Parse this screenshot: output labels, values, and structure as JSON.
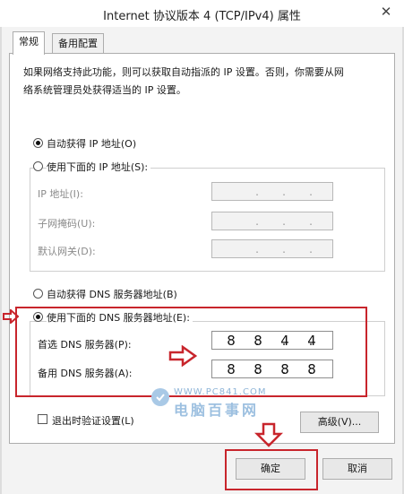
{
  "window": {
    "title": "Internet 协议版本 4 (TCP/IPv4) 属性"
  },
  "tabs": [
    {
      "label": "常规",
      "active": true
    },
    {
      "label": "备用配置",
      "active": false
    }
  ],
  "description": [
    "如果网络支持此功能，则可以获取自动指派的 IP 设置。否则，你需要从网",
    "络系统管理员处获得适当的 IP 设置。"
  ],
  "ip": {
    "auto_label": "自动获得 IP 地址(O)",
    "manual_label": "使用下面的 IP 地址(S):",
    "address_label": "IP 地址(I):",
    "subnet_label": "子网掩码(U):",
    "gateway_label": "默认网关(D):",
    "separator": "."
  },
  "dns": {
    "auto_label": "自动获得 DNS 服务器地址(B)",
    "manual_label": "使用下面的 DNS 服务器地址(E):",
    "preferred_label": "首选 DNS 服务器(P):",
    "alternate_label": "备用 DNS 服务器(A):",
    "preferred_octets": [
      "8",
      "8",
      "4",
      "4"
    ],
    "alternate_octets": [
      "8",
      "8",
      "8",
      "8"
    ]
  },
  "validate_label": "退出时验证设置(L)",
  "advanced_label": "高级(V)...",
  "ok_label": "确定",
  "cancel_label": "取消",
  "close_glyph": "✕",
  "watermark": {
    "url": "WWW.PC841.COM",
    "name": "电脑百事网"
  },
  "accent_color": "#c8252c"
}
